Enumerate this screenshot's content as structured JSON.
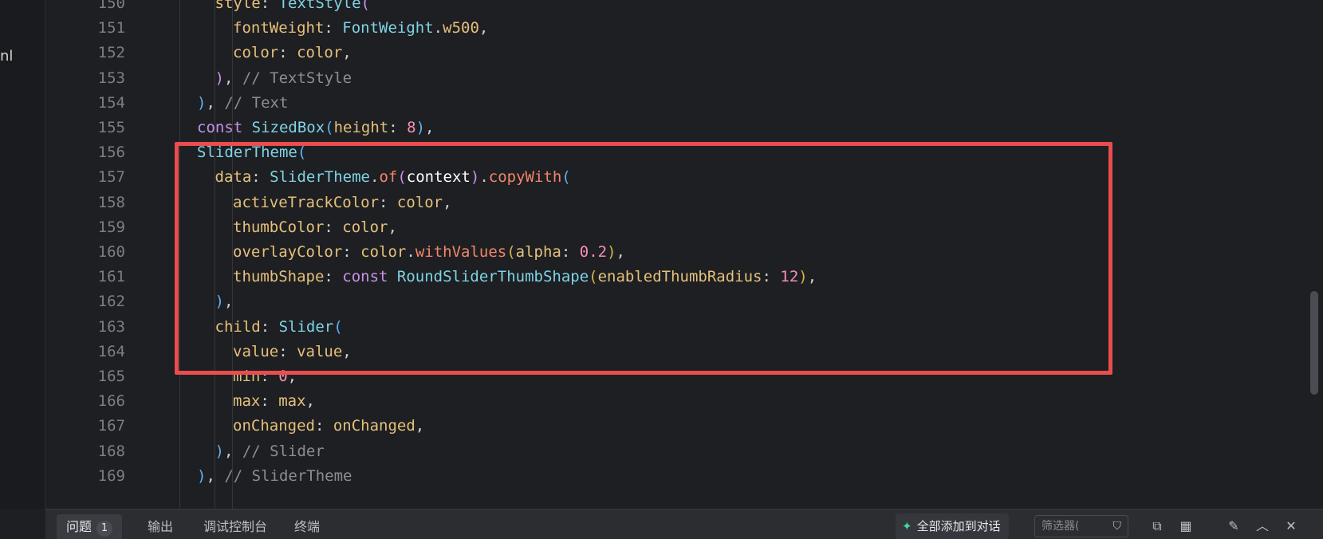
{
  "sidebar_fragment": "nl",
  "editor": {
    "lines": [
      {
        "no": "150",
        "indent": 1,
        "html": "<span class='tok-prop'>style</span><span class='tok-p'>: </span><span class='tok-cls'>TextStyle</span><span class='tok-pc'>(</span>"
      },
      {
        "no": "151",
        "indent": 2,
        "html": "<span class='tok-prop'>fontWeight</span><span class='tok-p'>: </span><span class='tok-cls'>FontWeight</span><span class='tok-p'>.</span><span class='tok-prop'>w500</span><span class='tok-p'>,</span>"
      },
      {
        "no": "152",
        "indent": 2,
        "html": "<span class='tok-prop'>color</span><span class='tok-p'>: </span><span class='tok-prop'>color</span><span class='tok-p'>,</span>"
      },
      {
        "no": "153",
        "indent": 1,
        "html": "<span class='tok-pc'>)</span><span class='tok-p'>, </span><span class='tok-cm'>// TextStyle</span>"
      },
      {
        "no": "154",
        "indent": 0,
        "html": "<span class='tok-pb'>)</span><span class='tok-p'>, </span><span class='tok-cm'>// Text</span>"
      },
      {
        "no": "155",
        "indent": 0,
        "html": "<span class='tok-kw'>const </span><span class='tok-cls'>SizedBox</span><span class='tok-pb'>(</span><span class='tok-prop'>height</span><span class='tok-p'>: </span><span class='tok-num'>8</span><span class='tok-pb'>)</span><span class='tok-p'>,</span>"
      },
      {
        "no": "156",
        "indent": 0,
        "html": "<span class='tok-cls'>SliderTheme</span><span class='tok-pb'>(</span>"
      },
      {
        "no": "157",
        "indent": 1,
        "html": "<span class='tok-prop'>data</span><span class='tok-p'>: </span><span class='tok-cls'>SliderTheme</span><span class='tok-p'>.</span><span class='tok-fn'>of</span><span class='tok-pc'>(</span><span class='tok-var'>context</span><span class='tok-pc'>)</span><span class='tok-p'>.</span><span class='tok-fn'>copyWith</span><span class='tok-pb'>(</span>"
      },
      {
        "no": "158",
        "indent": 2,
        "html": "<span class='tok-prop'>activeTrackColor</span><span class='tok-p'>: </span><span class='tok-prop'>color</span><span class='tok-p'>,</span>"
      },
      {
        "no": "159",
        "indent": 2,
        "html": "<span class='tok-prop'>thumbColor</span><span class='tok-p'>: </span><span class='tok-prop'>color</span><span class='tok-p'>,</span>"
      },
      {
        "no": "160",
        "indent": 2,
        "html": "<span class='tok-prop'>overlayColor</span><span class='tok-p'>: </span><span class='tok-prop'>color</span><span class='tok-p'>.</span><span class='tok-fn'>withValues</span><span class='tok-pa'>(</span><span class='tok-prop'>alpha</span><span class='tok-p'>: </span><span class='tok-num'>0.2</span><span class='tok-pa'>)</span><span class='tok-p'>,</span>"
      },
      {
        "no": "161",
        "indent": 2,
        "html": "<span class='tok-prop'>thumbShape</span><span class='tok-p'>: </span><span class='tok-kw'>const </span><span class='tok-cls'>RoundSliderThumbShape</span><span class='tok-pa'>(</span><span class='tok-prop'>enabledThumbRadius</span><span class='tok-p'>: </span><span class='tok-num'>12</span><span class='tok-pa'>)</span><span class='tok-p'>,</span>"
      },
      {
        "no": "162",
        "indent": 1,
        "html": "<span class='tok-pb'>)</span><span class='tok-p'>,</span>"
      },
      {
        "no": "163",
        "indent": 1,
        "html": "<span class='tok-prop'>child</span><span class='tok-p'>: </span><span class='tok-cls'>Slider</span><span class='tok-pb'>(</span>"
      },
      {
        "no": "164",
        "indent": 2,
        "html": "<span class='tok-prop'>value</span><span class='tok-p'>: </span><span class='tok-prop'>value</span><span class='tok-p'>,</span>"
      },
      {
        "no": "165",
        "indent": 2,
        "html": "<span class='tok-prop'>min</span><span class='tok-p'>: </span><span class='tok-num'>0</span><span class='tok-p'>,</span>"
      },
      {
        "no": "166",
        "indent": 2,
        "html": "<span class='tok-prop'>max</span><span class='tok-p'>: </span><span class='tok-prop'>max</span><span class='tok-p'>,</span>"
      },
      {
        "no": "167",
        "indent": 2,
        "html": "<span class='tok-prop'>onChanged</span><span class='tok-p'>: </span><span class='tok-prop'>onChanged</span><span class='tok-p'>,</span>"
      },
      {
        "no": "168",
        "indent": 1,
        "html": "<span class='tok-pb'>)</span><span class='tok-p'>, </span><span class='tok-cm'>// Slider</span>"
      },
      {
        "no": "169",
        "indent": 0,
        "html": "<span class='tok-pb'>)</span><span class='tok-p'>, </span><span class='tok-cm'>// SliderTheme</span>"
      }
    ]
  },
  "bottom_panel": {
    "tabs": [
      {
        "label": "问题",
        "badge": "1"
      },
      {
        "label": "输出",
        "badge": ""
      },
      {
        "label": "调试控制台",
        "badge": ""
      },
      {
        "label": "终端",
        "badge": ""
      }
    ],
    "add_all_label": "全部添加到对话",
    "filter_placeholder": "筛选器(",
    "icons": [
      "filter-icon",
      "copy-icon",
      "layout-icon",
      "edit-icon",
      "chevron-up-icon",
      "close-icon"
    ]
  },
  "colors": {
    "highlight_border": "#ea4d4d",
    "editor_bg": "#1e1f22"
  }
}
